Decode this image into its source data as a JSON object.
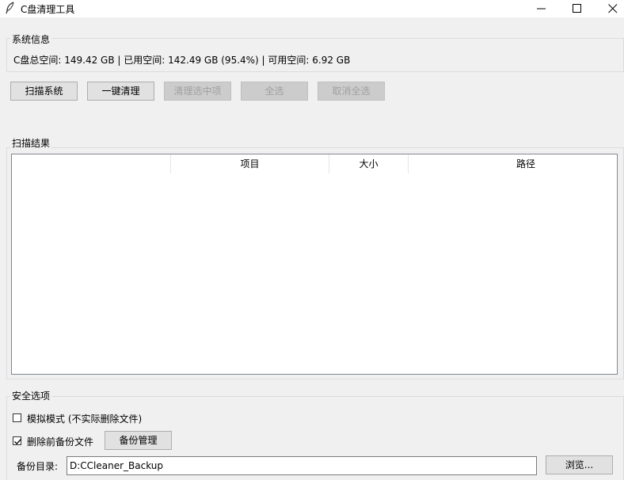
{
  "window": {
    "title": "C盘清理工具",
    "icon": "feather-icon",
    "controls": [
      "minimize-icon",
      "maximize-icon",
      "close-icon"
    ]
  },
  "system_info": {
    "frame_label": "系统信息",
    "disk_summary": "C盘总空间: 149.42 GB | 已用空间: 142.49 GB (95.4%) | 可用空间: 6.92 GB"
  },
  "toolbar": {
    "scan_label": "扫描系统",
    "one_click_clean_label": "一键清理",
    "clean_selected_label": "清理选中项",
    "select_all_label": "全选",
    "deselect_all_label": "取消全选"
  },
  "scan_results": {
    "frame_label": "扫描结果",
    "columns": [
      "",
      "项目",
      "大小",
      "路径"
    ],
    "rows": []
  },
  "safety": {
    "frame_label": "安全选项",
    "simulate_mode_label": "模拟模式 (不实际删除文件)",
    "simulate_mode_checked": false,
    "backup_before_delete_label": "删除前备份文件",
    "backup_before_delete_checked": true,
    "backup_manage_label": "备份管理",
    "backup_dir_label": "备份目录:",
    "backup_dir_value": "D:CCleaner_Backup",
    "browse_label": "浏览..."
  }
}
